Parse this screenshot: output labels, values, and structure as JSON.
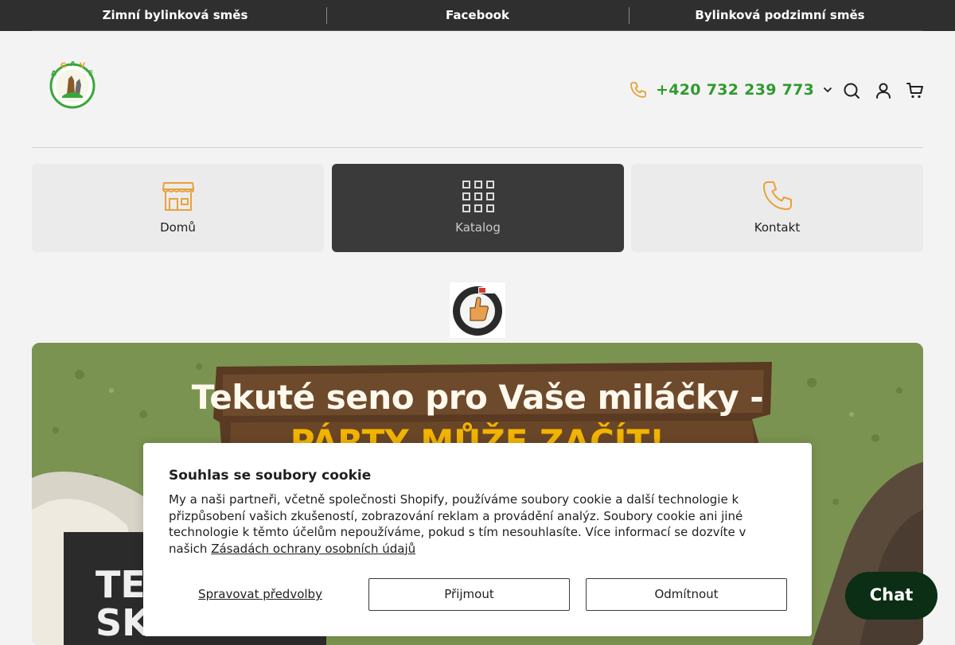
{
  "topbar": {
    "items": [
      {
        "label": "Zimní bylinková směs"
      },
      {
        "label": "Facebook"
      },
      {
        "label": "Bylinková podzimní směs"
      }
    ]
  },
  "header": {
    "logo_icon": "agave-logo",
    "phone": "+420 732 239 773",
    "phone_color": "#2f9a2f",
    "icons": [
      "search-icon",
      "account-icon",
      "cart-icon"
    ]
  },
  "nav": {
    "cards": [
      {
        "label": "Domů",
        "icon": "store-icon"
      },
      {
        "label": "Katalog",
        "icon": "grid-icon",
        "active": true
      },
      {
        "label": "Kontakt",
        "icon": "phone-icon"
      }
    ],
    "accent_color": "#e8a23a"
  },
  "badge": {
    "icon": "reliable-company-badge"
  },
  "hero": {
    "title": "Tekuté seno pro Vaše miláčky -",
    "subtitle": "PÁRTY MŮŽE ZAČÍT!",
    "big_text": "TE\nSK"
  },
  "cookie": {
    "title": "Souhlas se soubory cookie",
    "body": "My a naši partneři, včetně společnosti Shopify, používáme soubory cookie a další technologie k přizpůsobení vašich zkušeností, zobrazování reklam a provádění analýz. Soubory cookie ani jiné technologie k těmto účelům nepoužíváme, pokud s tím nesouhlasíte. Více informací se dozvíte v našich ",
    "link": "Zásadách ochrany osobních údajů",
    "manage": "Spravovat předvolby",
    "accept": "Přijmout",
    "decline": "Odmítnout"
  },
  "chat": {
    "label": "Chat"
  }
}
